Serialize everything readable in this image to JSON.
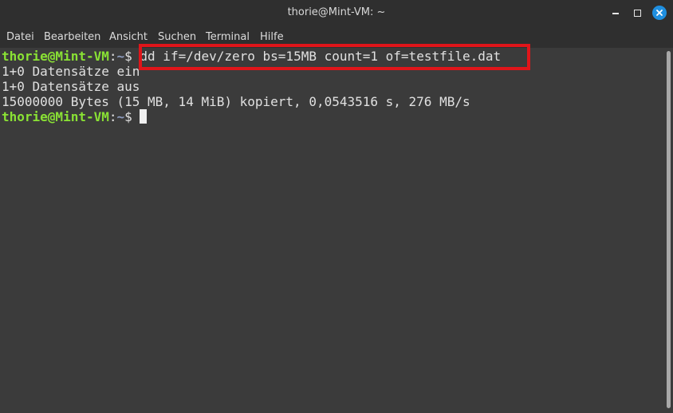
{
  "window": {
    "title": "thorie@Mint-VM: ~"
  },
  "menu": {
    "items": [
      "Datei",
      "Bearbeiten",
      "Ansicht",
      "Suchen",
      "Terminal",
      "Hilfe"
    ]
  },
  "terminal": {
    "prompt_user": "thorie@Mint-VM",
    "prompt_sep": ":",
    "prompt_path": "~",
    "prompt_symbol": "$ ",
    "command": "dd if=/dev/zero bs=15MB count=1 of=testfile.dat",
    "output": [
      "1+0 Datensätze ein",
      "1+0 Datensätze aus",
      "15000000 Bytes (15 MB, 14 MiB) kopiert, 0,0543516 s, 276 MB/s"
    ]
  },
  "icons": {
    "minimize": "minimize-icon",
    "maximize": "maximize-icon",
    "close": "close-icon"
  },
  "colors": {
    "prompt_user": "#8ae234",
    "prompt_path": "#8e9cbf",
    "highlight_border": "#e0151a",
    "close_button": "#1f8fe0"
  }
}
